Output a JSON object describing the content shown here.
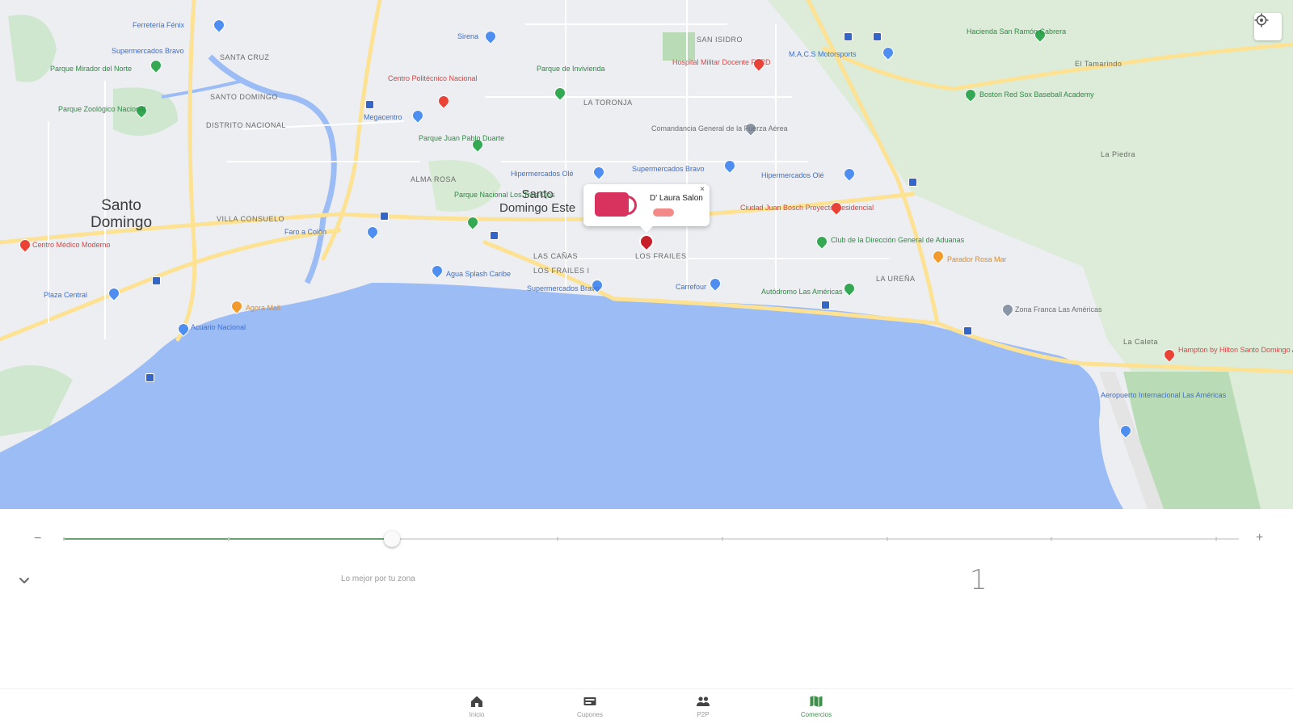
{
  "map": {
    "cities": [
      {
        "label": "Santo\nDomingo"
      },
      {
        "label": "Santo\nDomingo Este"
      }
    ],
    "districts": [
      "SANTA CRUZ",
      "SANTO DOMINGO",
      "DISTRITO NACIONAL",
      "ALMA ROSA",
      "LOS FRAILES",
      "LAS CAÑAS",
      "LOS FRAILES I",
      "LA TORONJA",
      "SAN ISIDRO",
      "LA UREÑA",
      "VILLA CONSUELO",
      "La Caleta",
      "La Piedra",
      "El Tamarindo"
    ],
    "pois": [
      {
        "name": "Ferretería Fénix",
        "color": "blue"
      },
      {
        "name": "Supermercados Bravo",
        "color": "green"
      },
      {
        "name": "Parque Mirador del Norte",
        "color": "green"
      },
      {
        "name": "Parque Zoológico Nacional",
        "color": "green"
      },
      {
        "name": "Sirena",
        "color": "blue"
      },
      {
        "name": "Megacentro",
        "color": "blue"
      },
      {
        "name": "Centro Politécnico Nacional",
        "color": "red"
      },
      {
        "name": "Parque de Invivienda",
        "color": "green"
      },
      {
        "name": "Parque Juan Pablo Duarte",
        "color": "green"
      },
      {
        "name": "Hipermercados Olé",
        "color": "blue"
      },
      {
        "name": "Supermercados Bravo",
        "color": "blue"
      },
      {
        "name": "Hipermercados Olé",
        "color": "blue"
      },
      {
        "name": "Hospital Militar Docente FARD",
        "color": "red"
      },
      {
        "name": "M.A.C.S Motorsports",
        "color": "blue"
      },
      {
        "name": "Comandancia General de la Fuerza Aérea",
        "color": "gray"
      },
      {
        "name": "Ciudad Juan Bosch Proyecto Residencial",
        "color": "red"
      },
      {
        "name": "Parque Nacional Los Tres Ojos",
        "color": "green"
      },
      {
        "name": "Faro a Colón",
        "color": "blue"
      },
      {
        "name": "Agua Splash Caribe",
        "color": "blue"
      },
      {
        "name": "Supermercados Bravo",
        "color": "blue"
      },
      {
        "name": "Carrefour",
        "color": "blue"
      },
      {
        "name": "Autódromo Las Américas",
        "color": "green"
      },
      {
        "name": "Club de la Dirección General de Aduanas",
        "color": "green"
      },
      {
        "name": "Hacienda San Ramón Cabrera",
        "color": "green"
      },
      {
        "name": "Boston Red Sox Baseball Academy",
        "color": "green"
      },
      {
        "name": "Parador Rosa Mar",
        "color": "orange"
      },
      {
        "name": "Centro Médico Moderno",
        "color": "red"
      },
      {
        "name": "Plaza Central",
        "color": "blue"
      },
      {
        "name": "Acuario Nacional",
        "color": "blue"
      },
      {
        "name": "Hampton by Hilton Santo Domingo Airport",
        "color": "red"
      },
      {
        "name": "Aeropuerto Internacional Las Américas",
        "color": "blue"
      },
      {
        "name": "Zona Franca Las Américas",
        "color": "gray"
      },
      {
        "name": "Agora Mall",
        "color": "orange"
      }
    ],
    "popup": {
      "title": "D' Laura Salon",
      "close": "×"
    }
  },
  "slider": {
    "minus": "−",
    "plus": "+",
    "value_fraction": 0.28
  },
  "zone": {
    "caption": "Lo mejor por tu zona",
    "count": "1"
  },
  "nav": {
    "items": [
      {
        "label": "Inicio",
        "icon": "home-icon"
      },
      {
        "label": "Cupones",
        "icon": "coupon-icon"
      },
      {
        "label": "P2P",
        "icon": "people-icon"
      },
      {
        "label": "Comercios",
        "icon": "map-icon",
        "active": true
      }
    ]
  },
  "colors": {
    "water": "#9cbcf6",
    "land": "#eceef1",
    "park": "#cfe7cf",
    "road": "#fde293",
    "accent": "#3f8f4a",
    "marker": "#c8202b"
  }
}
